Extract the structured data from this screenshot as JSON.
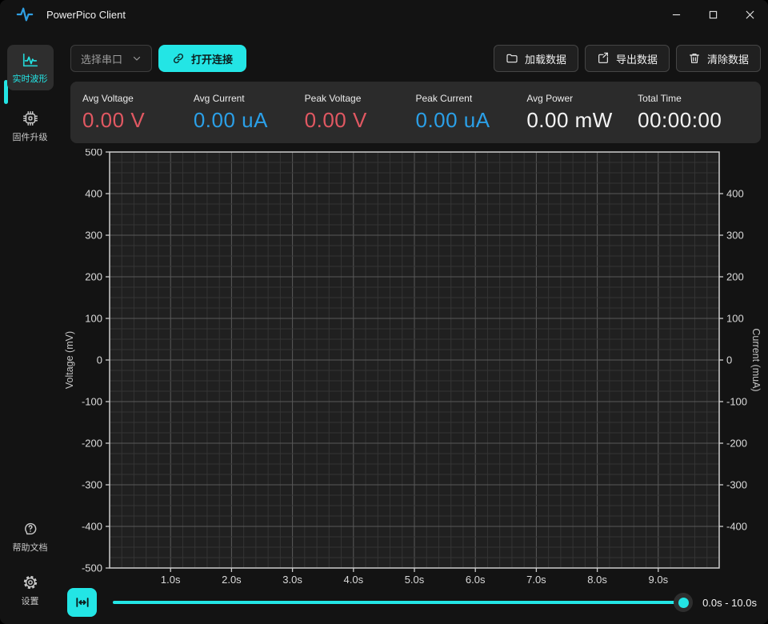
{
  "titlebar": {
    "title": "PowerPico Client"
  },
  "sidebar": {
    "items": [
      {
        "label": "实时波形",
        "icon": "waveform-icon",
        "active": true
      },
      {
        "label": "固件升级",
        "icon": "chip-icon",
        "active": false
      }
    ],
    "bottom_items": [
      {
        "label": "帮助文档",
        "icon": "help-icon"
      },
      {
        "label": "设置",
        "icon": "gear-icon"
      }
    ]
  },
  "toolbar": {
    "port_select_label": "选择串口",
    "connect_label": "打开连接",
    "load_label": "加载数据",
    "export_label": "导出数据",
    "clear_label": "清除数据"
  },
  "stats": {
    "items": [
      {
        "label": "Avg Voltage",
        "value": "0.00 V",
        "color": "#e15862"
      },
      {
        "label": "Avg Current",
        "value": "0.00 uA",
        "color": "#2ba0e8"
      },
      {
        "label": "Peak Voltage",
        "value": "0.00 V",
        "color": "#e15862"
      },
      {
        "label": "Peak Current",
        "value": "0.00 uA",
        "color": "#2ba0e8"
      },
      {
        "label": "Avg Power",
        "value": "0.00 mW",
        "color": "#f5f5f5"
      },
      {
        "label": "Total Time",
        "value": "00:00:00",
        "color": "#f5f5f5"
      }
    ]
  },
  "chart_data": {
    "type": "line",
    "title": "",
    "xlabel": "",
    "ylabel_left": "Voltage (mV)",
    "ylabel_right": "Current (muA)",
    "xlim": [
      0,
      10
    ],
    "ylim": [
      -500,
      500
    ],
    "xticks": [
      "1.0s",
      "2.0s",
      "3.0s",
      "4.0s",
      "5.0s",
      "6.0s",
      "7.0s",
      "8.0s",
      "9.0s"
    ],
    "yticks_left": [
      "500",
      "400",
      "300",
      "200",
      "100",
      "0",
      "-100",
      "-200",
      "-300",
      "-400",
      "-500"
    ],
    "yticks_right": [
      "400",
      "300",
      "200",
      "100",
      "0",
      "-100",
      "-200",
      "-300",
      "-400"
    ],
    "grid": {
      "visible": true,
      "major_x": 1,
      "minor_x": 0.2,
      "major_y": 100,
      "minor_y": 25
    },
    "series": [],
    "colors": {
      "plot_bg": "#202020",
      "minor_grid": "#343434",
      "major_grid": "#595959",
      "spine": "#cdcdcd",
      "tick_label": "#dadada",
      "axis_label": "#c4c4c4"
    }
  },
  "bottombar": {
    "range_label": "0.0s - 10.0s",
    "slider_value_pct": 100
  },
  "colors": {
    "accent": "#23e5e5",
    "bg": "#131313",
    "panel": "#2b2b2b"
  },
  "icons": {
    "logo": "waveform glyph (cyan-blue pulse)",
    "window": [
      "minimize-icon",
      "maximize-icon",
      "close-icon"
    ],
    "port_chevron": "chevron-down",
    "connect": "chain-link",
    "load": "folder",
    "export": "share-arrow",
    "clear": "trash",
    "fit": "fit-width (|<->|)"
  }
}
